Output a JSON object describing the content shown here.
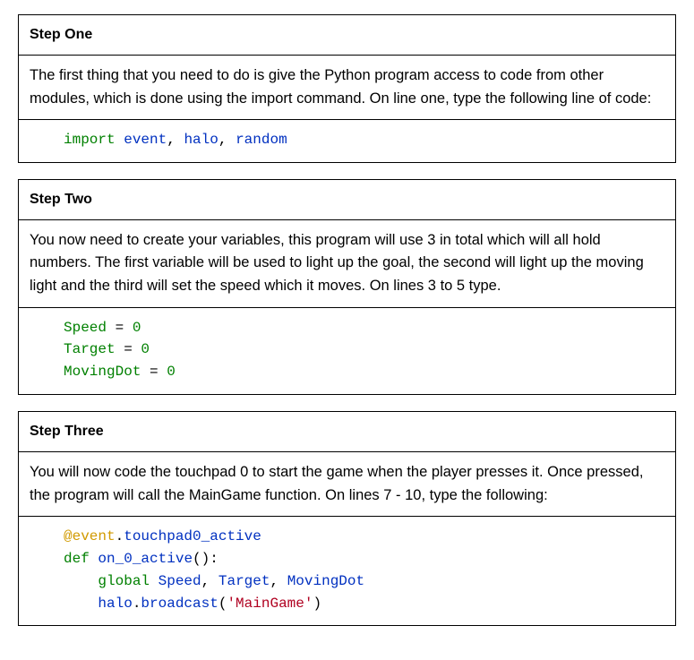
{
  "steps": [
    {
      "title": "Step One",
      "desc": "The first thing that you need to do is give the Python program access to code from other modules, which is done using the import command. On line one, type the following line of code:",
      "code": {
        "import_kw": "import",
        "sp1": " ",
        "mod_event": "event",
        "comma1": ",",
        "sp2": " ",
        "mod_halo": "halo",
        "comma2": ",",
        "sp3": " ",
        "mod_random": "random"
      }
    },
    {
      "title": "Step Two",
      "desc": "You now need to create your variables, this program will use 3 in total which will all hold numbers. The first variable will be used to light up the goal, the second will light up the moving light and the third will set the speed which it moves. On lines 3 to 5 type.",
      "code": {
        "l1_name": "Speed",
        "l1_eq": " = ",
        "l1_val": "0",
        "l2_name": "Target",
        "l2_eq": " = ",
        "l2_val": "0",
        "l3_name": "MovingDot",
        "l3_eq": " = ",
        "l3_val": "0"
      }
    },
    {
      "title": "Step Three",
      "desc": "You will now code the touchpad 0 to start the game when the player presses it. Once pressed, the program will call the MainGame function. On lines 7 - 10, type the following:",
      "code": {
        "decor_at": "@event",
        "decor_dot": ".",
        "decor_attr": "touchpad0_active",
        "def_kw": "def",
        "sp_def": " ",
        "fn_name": "on_0_active",
        "fn_par": "():",
        "indent": "    ",
        "global_kw": "global",
        "sp_g": " ",
        "g_v1": "Speed",
        "g_c1": ",",
        "g_sp1": " ",
        "g_v2": "Target",
        "g_c2": ",",
        "g_sp2": " ",
        "g_v3": "MovingDot",
        "halo_obj": "halo",
        "halo_dot": ".",
        "halo_fn": "broadcast",
        "halo_open": "(",
        "halo_str": "'MainGame'",
        "halo_close": ")"
      }
    }
  ]
}
